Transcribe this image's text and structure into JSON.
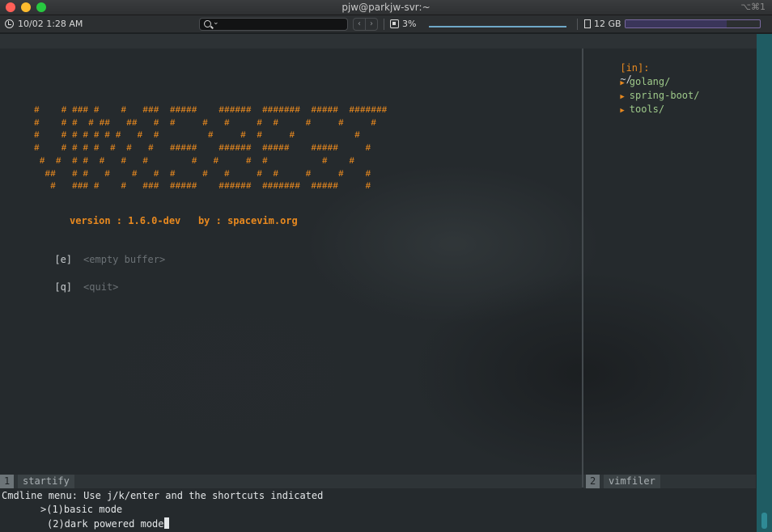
{
  "window": {
    "title": "pjw@parkjw-svr:~",
    "shortcut": "⌥⌘1",
    "close_icon": "close-icon",
    "minimize_icon": "minimize-icon",
    "maximize_icon": "maximize-icon"
  },
  "status_bar": {
    "datetime": "10/02 1:28 AM",
    "search_placeholder": "",
    "nav_back": "‹",
    "nav_forward": "›",
    "cpu": "3%",
    "memory": "12 GB",
    "memory_fraction": 0.75,
    "colors": {
      "cpu_graph": "#6fa8c8",
      "memory_graph": "#7a6aa0"
    }
  },
  "startify": {
    "banner": "#    # ### #    #   ###  #####    ######  #######  #####  #######\n#    # #  # ##   ##   #  #     #   #     #  #     #     #     #\n#    # # # # # #   #  #         #     #  #     #           #\n#    # # # #  #  #   #   #####    ######  #####    #####     #\n #  #  # #  #   #   #        #   #     #  #          #    #\n  ##   # #   #    #   #  #     #   #     #  #     #     #    #\n   #   ### #    #   ###  #####    ######  #######  #####     #",
    "version_line": "version : 1.6.0-dev   by : spacevim.org",
    "items": [
      {
        "key": "[e]",
        "label": "<empty buffer>"
      },
      {
        "key": "[q]",
        "label": "<quit>"
      }
    ]
  },
  "vimfiler": {
    "header_tag": "[in]:",
    "header_path": "~/",
    "entries": [
      "golang/",
      "spring-boot/",
      "tools/"
    ]
  },
  "statusline": {
    "left": {
      "number": "1",
      "name": "startify"
    },
    "right": {
      "number": "2",
      "name": "vimfiler"
    }
  },
  "cmdline": {
    "prompt": "Cmdline menu: Use j/k/enter and the shortcuts indicated",
    "options": [
      ">(1)basic mode",
      "(2)dark powered mode"
    ]
  },
  "colors": {
    "accent": "#e8891f",
    "directory": "#9ec98a",
    "background": "#252a2d"
  }
}
